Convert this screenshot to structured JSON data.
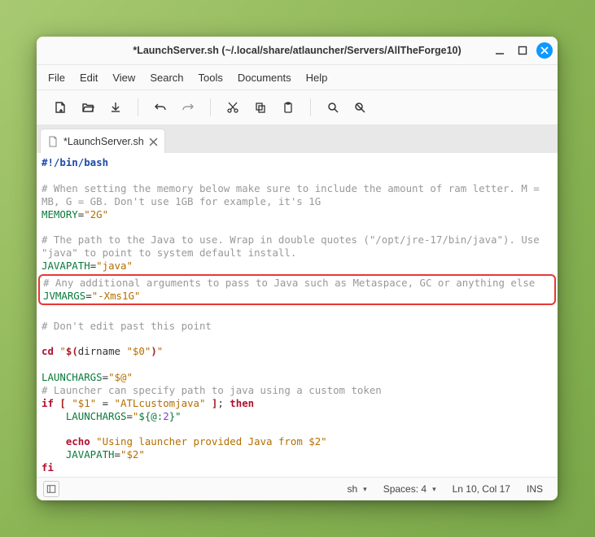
{
  "titlebar": {
    "title": "*LaunchServer.sh (~/.local/share/atlauncher/Servers/AllTheForge10)"
  },
  "menubar": {
    "items": [
      "File",
      "Edit",
      "View",
      "Search",
      "Tools",
      "Documents",
      "Help"
    ]
  },
  "tab": {
    "label": "*LaunchServer.sh"
  },
  "code": {
    "shebang": "#!/bin/bash",
    "comment_mem1": "# When setting the memory below make sure to include the amount of ram letter. M = MB, G = GB. Don't use 1GB for example, it's 1G",
    "memory_var": "MEMORY",
    "memory_val": "\"2G\"",
    "comment_java1": "# The path to the Java to use. Wrap in double quotes (\"/opt/jre-17/bin/java\"). Use \"java\" to point to system default install.",
    "javapath_var": "JAVAPATH",
    "javapath_val": "\"java\"",
    "comment_jvm": "# Any additional arguments to pass to Java such as Metaspace, GC or anything else",
    "jvmargs_var": "JVMARGS",
    "jvmargs_val": "\"-Xms1G\"",
    "comment_noedit": "# Don't edit past this point",
    "cd_kw": "cd",
    "cd_q1": "\"",
    "cd_sub_open": "$(",
    "cd_dirname": "dirname ",
    "cd_arg": "\"$0\"",
    "cd_sub_close": ")",
    "cd_q2": "\"",
    "launchargs_var": "LAUNCHARGS",
    "launchargs_val": "\"$@\"",
    "comment_launcher": "# Launcher can specify path to java using a custom token",
    "if_kw": "if",
    "if_lb": " [ ",
    "if_var1": "\"$1\"",
    "if_eq": " = ",
    "if_val": "\"ATLcustomjava\"",
    "if_rb": " ]",
    "if_semi": "; ",
    "then_kw": "then",
    "la2_var": "LAUNCHARGS",
    "la2_val_q1": "\"",
    "la2_val_inner": "${@:",
    "la2_val_num": "2",
    "la2_val_close": "}\"",
    "echo_kw": "echo",
    "echo_val": "\"Using launcher provided Java from $2\"",
    "jp2_var": "JAVAPATH",
    "jp2_val": "\"$2\"",
    "fi_kw": "fi"
  },
  "statusbar": {
    "lang": "sh",
    "spaces": "Spaces: 4",
    "pos": "Ln 10, Col 17",
    "ins": "INS"
  }
}
